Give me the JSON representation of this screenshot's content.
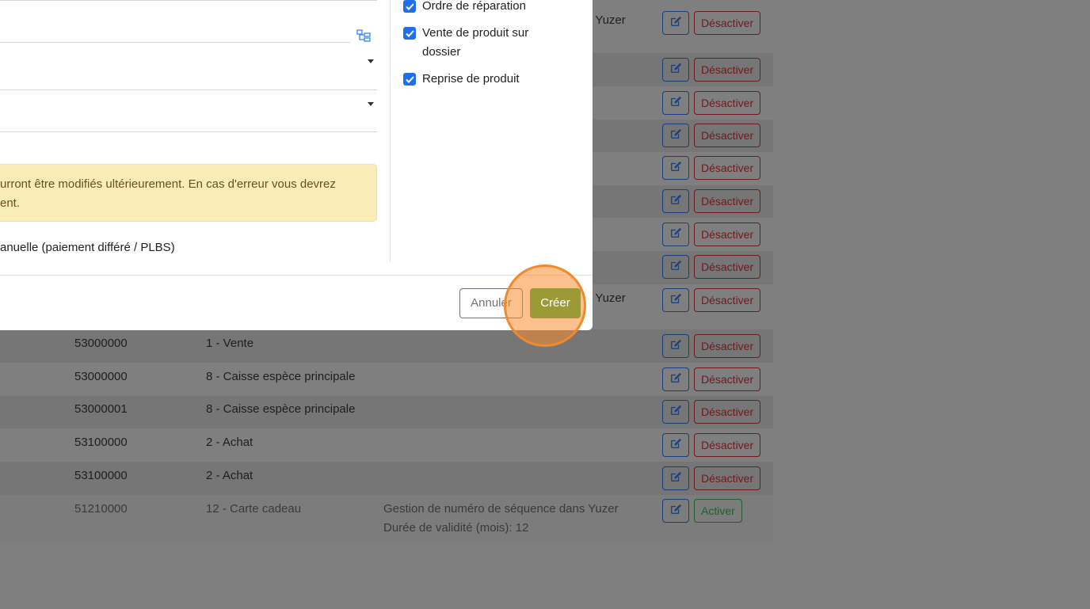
{
  "background_table": {
    "rows": [
      {
        "code": "",
        "type": "",
        "info": [
          "s Yuzer"
        ],
        "toggle": "Désactiver"
      },
      {
        "code": "",
        "type": "",
        "info": [],
        "toggle": "Désactiver"
      },
      {
        "code": "",
        "type": "",
        "info": [],
        "toggle": "Désactiver"
      },
      {
        "code": "",
        "type": "",
        "info": [],
        "toggle": "Désactiver"
      },
      {
        "code": "",
        "type": "",
        "info": [],
        "toggle": "Désactiver"
      },
      {
        "code": "",
        "type": "",
        "info": [],
        "toggle": "Désactiver"
      },
      {
        "code": "",
        "type": "",
        "info": [],
        "toggle": "Désactiver"
      },
      {
        "code": "",
        "type": "",
        "info": [],
        "toggle": "Désactiver"
      },
      {
        "code": "",
        "type": "",
        "info": [
          "s Yuzer"
        ],
        "toggle": "Désactiver"
      },
      {
        "code": "53000000",
        "type": "1 - Vente",
        "info": [],
        "toggle": "Désactiver"
      },
      {
        "code": "53000000",
        "type": "8 - Caisse espèce principale",
        "info": [],
        "toggle": "Désactiver"
      },
      {
        "code": "53000001",
        "type": "8 - Caisse espèce principale",
        "info": [],
        "toggle": "Désactiver"
      },
      {
        "code": "53100000",
        "type": "2 - Achat",
        "info": [],
        "toggle": "Désactiver"
      },
      {
        "code": "53100000",
        "type": "2 - Achat",
        "info": [],
        "toggle": "Désactiver"
      },
      {
        "code": "51210000",
        "type": "12 - Carte cadeau",
        "info": [
          "Gestion de numéro de séquence dans Yuzer",
          "Durée de validité (mois): 12"
        ],
        "toggle": "Activer"
      }
    ]
  },
  "modal": {
    "warning_line1": "urront être modifiés ultérieurement. En cas d'erreur vous devrez",
    "warning_line2": "ent.",
    "manual_label": "anuelle (paiement différé / PLBS)",
    "checkboxes": [
      {
        "label": "Ordre de réparation",
        "checked": true
      },
      {
        "label_line1": "Vente de produit sur",
        "label_line2": "dossier",
        "checked": true
      },
      {
        "label": "Reprise de produit",
        "checked": true
      }
    ],
    "cancel_label": "Annuler",
    "create_label": "Créer"
  },
  "colors": {
    "primary": "#1f6feb",
    "create_button": "#9b9a37",
    "highlight": "#f08a2c",
    "warning_bg": "#f9ecb7"
  }
}
